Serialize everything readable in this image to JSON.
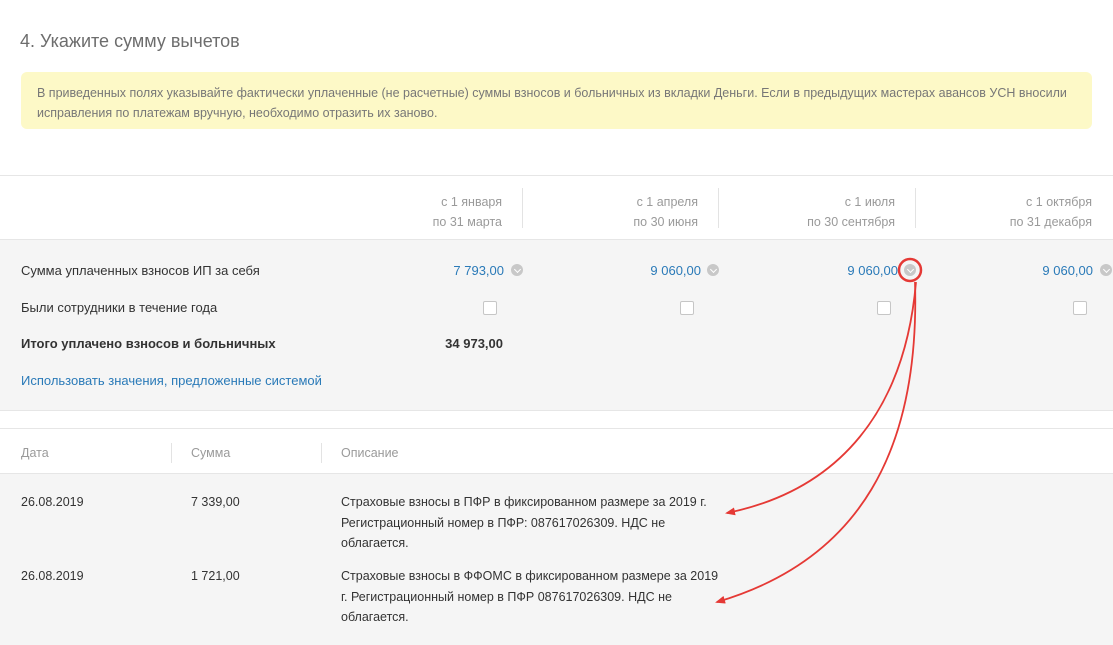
{
  "page": {
    "title": "4. Укажите сумму вычетов",
    "notice": "В приведенных полях указывайте фактически уплаченные (не расчетные) суммы взносов и больничных из вкладки Деньги. Если в предыдущих мастерах авансов УСН вносили исправления по платежам вручную, необходимо отразить их заново."
  },
  "periods": [
    {
      "from": "с 1 января",
      "to": "по 31 марта"
    },
    {
      "from": "с 1 апреля",
      "to": "по 30 июня"
    },
    {
      "from": "с 1 июля",
      "to": "по 30 сентября"
    },
    {
      "from": "с 1 октября",
      "to": "по 31 декабря"
    }
  ],
  "summary": {
    "contributions_label": "Сумма уплаченных взносов ИП за себя",
    "contributions": [
      "7 793,00",
      "9 060,00",
      "9 060,00",
      "9 060,00"
    ],
    "employees_label": "Были сотрудники в течение года",
    "employees_checked": [
      false,
      false,
      false,
      false
    ],
    "total_label": "Итого уплачено взносов и больничных",
    "total_value": "34 973,00",
    "suggest_link": "Использовать значения, предложенные системой"
  },
  "table": {
    "headers": {
      "date": "Дата",
      "amount": "Сумма",
      "description": "Описание"
    },
    "rows": [
      {
        "date": "26.08.2019",
        "amount": "7 339,00",
        "description_lines": [
          "Страховые взносы в ПФР в фиксированном размере за 2019 г.",
          "Регистрационный номер в ПФР: 087617026309. НДС не",
          "облагается."
        ]
      },
      {
        "date": "26.08.2019",
        "amount": "1 721,00",
        "description_lines": [
          "Страховые взносы в ФФОМС в фиксированном размере за 2019",
          "г. Регистрационный номер в ПФР 087617026309. НДС не",
          "облагается."
        ]
      }
    ]
  },
  "colors": {
    "link": "#2a7ab8",
    "notice_bg": "#fdf9c7",
    "annotation": "#e53935"
  }
}
